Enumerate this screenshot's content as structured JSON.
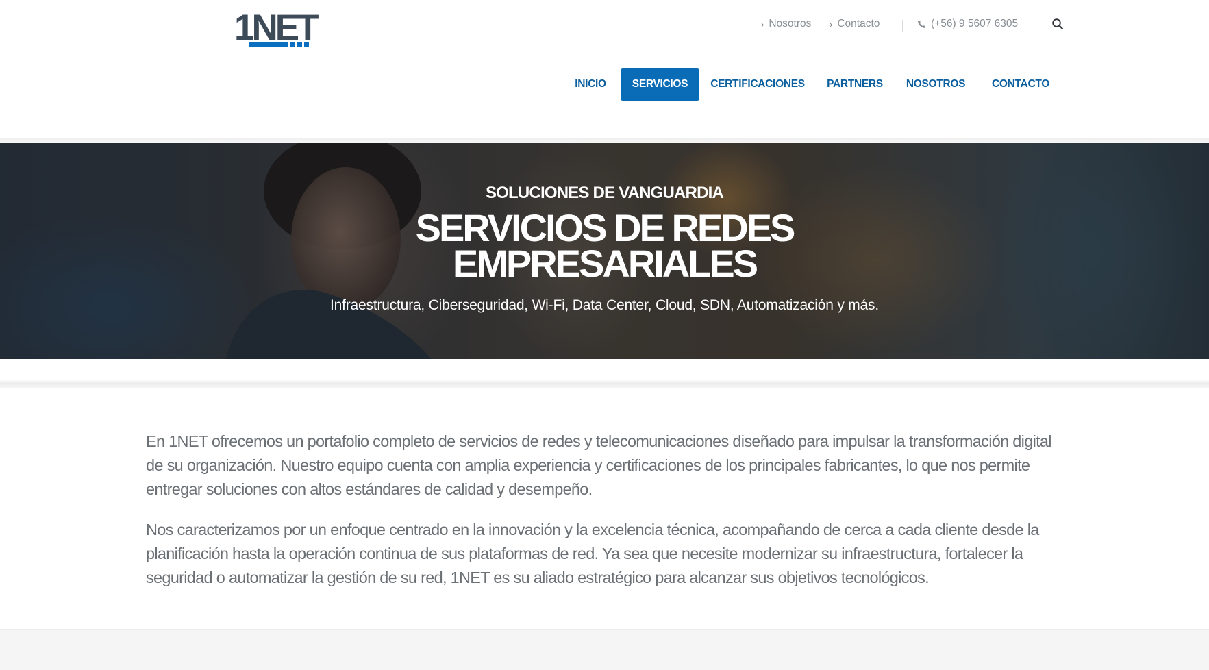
{
  "brand": {
    "logo_text": "1NET",
    "logo_color": "#3d4a57",
    "accent": "#0a6fc0"
  },
  "topbar": {
    "links": [
      {
        "label": "Nosotros",
        "icon": "chevron-right-icon"
      },
      {
        "label": "Contacto",
        "icon": "chevron-right-icon"
      }
    ],
    "phone": "(+56) 9 5607 6305",
    "phone_icon": "phone-icon",
    "search_icon": "search-icon"
  },
  "nav": {
    "items": [
      {
        "label": "INICIO",
        "active": false
      },
      {
        "label": "SERVICIOS",
        "active": true
      },
      {
        "label": "CERTIFICACIONES",
        "active": false
      },
      {
        "label": "PARTNERS",
        "active": false
      },
      {
        "label": "NOSOTROS",
        "active": false
      },
      {
        "label": "CONTACTO",
        "active": false
      }
    ],
    "active_color": "#0a6cb6",
    "text_color": "#0b5f9f"
  },
  "hero": {
    "eyebrow": "SOLUCIONES DE VANGUARDIA",
    "title_line1": "SERVICIOS DE REDES",
    "title_line2": "EMPRESARIALES",
    "subtitle": "Infraestructura, Ciberseguridad, Wi-Fi, Data Center, Cloud, SDN, Automatización y más."
  },
  "intro": {
    "paragraphs": [
      "En 1NET ofrecemos un portafolio completo de servicios de redes y telecomunicaciones diseñado para impulsar la transformación digital de su organización. Nuestro equipo cuenta con amplia experiencia y certificaciones de los principales fabricantes, lo que nos permite entregar soluciones con altos estándares de calidad y desempeño.",
      "Nos caracterizamos por un enfoque centrado en la innovación y la excelencia técnica, acompañando de cerca a cada cliente desde la planificación hasta la operación continua de sus plataformas de red. Ya sea que necesite modernizar su infraestructura, fortalecer la seguridad o automatizar la gestión de su red, 1NET es su aliado estratégico para alcanzar sus objetivos tecnológicos."
    ]
  }
}
